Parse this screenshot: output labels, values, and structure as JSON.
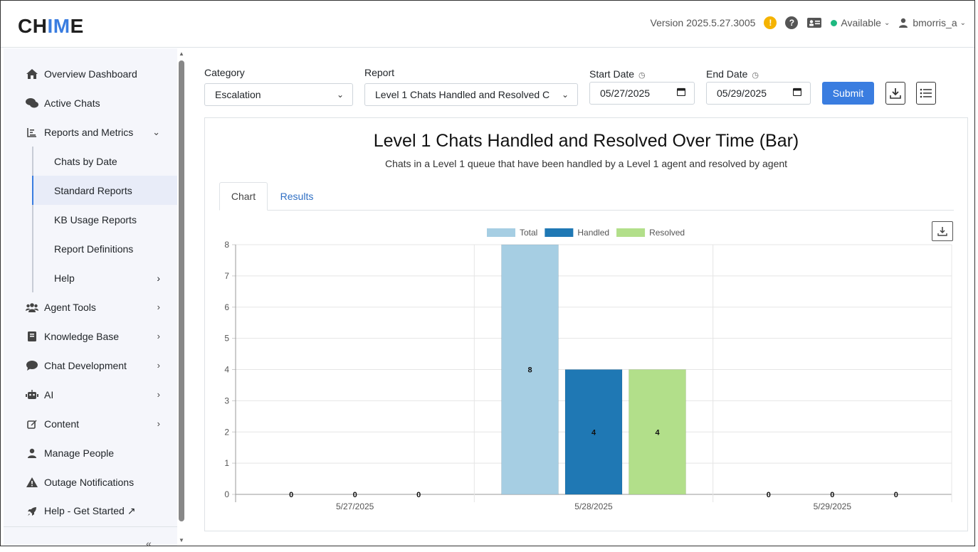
{
  "header": {
    "logo_pre": "CH",
    "logo_accent": "IM",
    "logo_post": "E",
    "version": "Version 2025.5.27.3005",
    "status": "Available",
    "user": "bmorris_a",
    "status_color": "#1eb980",
    "warn_color": "#f5b301"
  },
  "sidebar": {
    "items": [
      {
        "label": "Overview Dashboard",
        "icon": "home-icon"
      },
      {
        "label": "Active Chats",
        "icon": "chats-icon"
      },
      {
        "label": "Reports and Metrics",
        "icon": "chart-icon"
      },
      {
        "label": "Agent Tools",
        "icon": "users-icon"
      },
      {
        "label": "Knowledge Base",
        "icon": "book-icon"
      },
      {
        "label": "Chat Development",
        "icon": "comment-icon"
      },
      {
        "label": "AI",
        "icon": "robot-icon"
      },
      {
        "label": "Content",
        "icon": "edit-icon"
      },
      {
        "label": "Manage People",
        "icon": "user-icon"
      },
      {
        "label": "Outage Notifications",
        "icon": "warning-icon"
      },
      {
        "label": "Help - Get Started ↗",
        "icon": "rocket-icon"
      }
    ],
    "sub_items": [
      {
        "label": "Chats by Date"
      },
      {
        "label": "Standard Reports"
      },
      {
        "label": "KB Usage Reports"
      },
      {
        "label": "Report Definitions"
      },
      {
        "label": "Help"
      }
    ]
  },
  "form": {
    "category_label": "Category",
    "category_value": "Escalation",
    "report_label": "Report",
    "report_value": "Level 1 Chats Handled and Resolved C",
    "start_label": "Start Date",
    "start_value": "05/27/2025",
    "end_label": "End Date",
    "end_value": "05/29/2025",
    "submit": "Submit"
  },
  "report": {
    "title": "Level 1 Chats Handled and Resolved Over Time (Bar)",
    "subtitle": "Chats in a Level 1 queue that have been handled by a Level 1 agent and resolved by agent",
    "tabs": [
      "Chart",
      "Results"
    ]
  },
  "chart_data": {
    "type": "bar",
    "categories": [
      "5/27/2025",
      "5/28/2025",
      "5/29/2025"
    ],
    "series": [
      {
        "name": "Total",
        "values": [
          0,
          8,
          0
        ],
        "color": "#a6cee3"
      },
      {
        "name": "Handled",
        "values": [
          0,
          4,
          0
        ],
        "color": "#1f78b4"
      },
      {
        "name": "Resolved",
        "values": [
          0,
          4,
          0
        ],
        "color": "#b2df8a"
      }
    ],
    "ylim": [
      0,
      8
    ],
    "yticks": [
      0,
      1,
      2,
      3,
      4,
      5,
      6,
      7,
      8
    ],
    "grid": true,
    "legend": "top"
  }
}
